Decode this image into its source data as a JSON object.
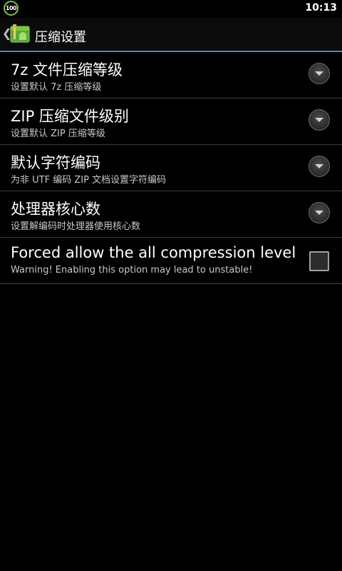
{
  "status_bar": {
    "battery_level": "100",
    "clock": "10:13",
    "accent_color": "#7ec63b"
  },
  "title_bar": {
    "back_icon": "chevron-left-icon",
    "app_icon": "archive-app-icon",
    "title": "压缩设置",
    "divider_color": "#3d8fc9"
  },
  "settings": [
    {
      "title": "7z 文件压缩等级",
      "summary": "设置默认 7z 压缩等级",
      "control": "dropdown"
    },
    {
      "title": "ZIP 压缩文件级别",
      "summary": "设置默认 ZIP 压缩等级",
      "control": "dropdown"
    },
    {
      "title": "默认字符编码",
      "summary": "为非 UTF 编码 ZIP 文档设置字符编码",
      "control": "dropdown"
    },
    {
      "title": "处理器核心数",
      "summary": "设置解编码时处理器使用核心数",
      "control": "dropdown"
    },
    {
      "title": "Forced allow the all compression level",
      "summary": "Warning! Enabling this option may lead to unstable!",
      "control": "checkbox",
      "checked": false
    }
  ]
}
